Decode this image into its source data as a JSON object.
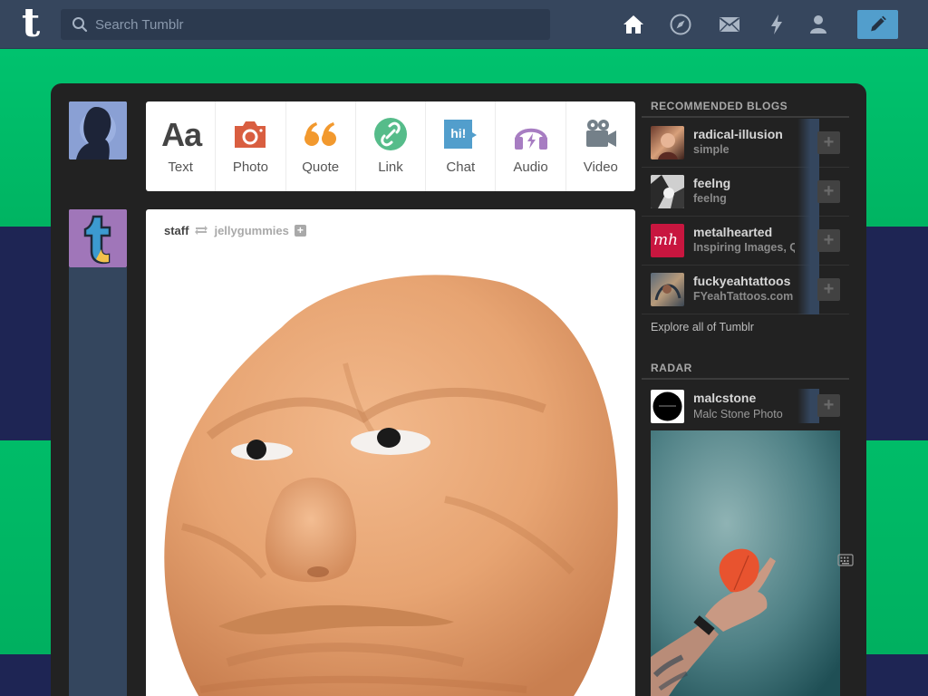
{
  "header": {
    "logo": "t",
    "search_placeholder": "Search Tumblr",
    "nav": [
      "home-icon",
      "explore-icon",
      "inbox-icon",
      "activity-icon",
      "account-icon"
    ],
    "compose_icon": "pencil-icon"
  },
  "post_types": [
    {
      "label": "Text",
      "icon": "text-icon",
      "color": "#444444",
      "glyph": "Aa"
    },
    {
      "label": "Photo",
      "icon": "camera-icon",
      "color": "#d95e40"
    },
    {
      "label": "Quote",
      "icon": "quote-icon",
      "color": "#f2992e"
    },
    {
      "label": "Link",
      "icon": "link-icon",
      "color": "#56bc8a"
    },
    {
      "label": "Chat",
      "icon": "chat-icon",
      "color": "#529ecc",
      "glyph": "hi!"
    },
    {
      "label": "Audio",
      "icon": "headphones-icon",
      "color": "#a77dc2"
    },
    {
      "label": "Video",
      "icon": "video-camera-icon",
      "color": "#748089"
    }
  ],
  "post": {
    "author": "staff",
    "reblogged_from": "jellygummies",
    "image": "clay-face-sculpture"
  },
  "recommended": {
    "title": "RECOMMENDED BLOGS",
    "blogs": [
      {
        "name": "radical-illusion",
        "title": "simple"
      },
      {
        "name": "feelng",
        "title": "feelng"
      },
      {
        "name": "metalhearted",
        "title": "Inspiring Images, Qu",
        "avatar_text": "mh"
      },
      {
        "name": "fuckyeahtattoos",
        "title": "FYeahTattoos.com"
      }
    ],
    "explore": "Explore all of Tumblr"
  },
  "radar": {
    "title": "RADAR",
    "blog": {
      "name": "malcstone",
      "title": "Malc Stone Photo"
    },
    "image": "hand-holding-red-leaf"
  },
  "colors": {
    "header": "#36465d",
    "accent": "#529ecc",
    "dashboard": "#222222",
    "background_green": "#00b866",
    "background_navy": "#1e2554"
  }
}
